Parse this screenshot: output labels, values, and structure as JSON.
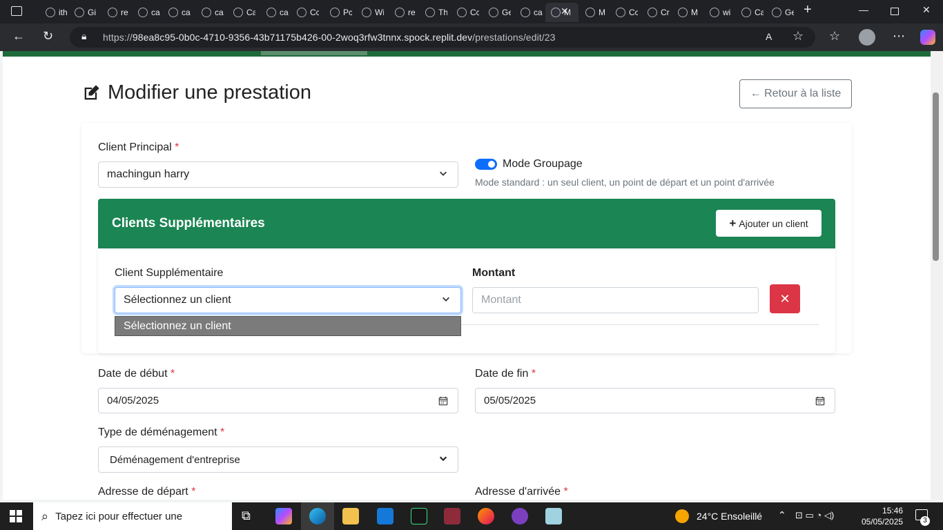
{
  "browser": {
    "tabs": [
      {
        "label": "ith",
        "icon": "search-icon"
      },
      {
        "label": "Gi",
        "icon": "github-icon"
      },
      {
        "label": "re",
        "icon": "search-icon"
      },
      {
        "label": "ca",
        "icon": "replit-icon"
      },
      {
        "label": "ca",
        "icon": "globe-icon"
      },
      {
        "label": "ca",
        "icon": "github-icon"
      },
      {
        "label": "Ca",
        "icon": "globe-icon"
      },
      {
        "label": "ca",
        "icon": "github-icon"
      },
      {
        "label": "Cc",
        "icon": "code-icon"
      },
      {
        "label": "Pc",
        "icon": "code-icon"
      },
      {
        "label": "Wi",
        "icon": "w-icon"
      },
      {
        "label": "re",
        "icon": "search-icon"
      },
      {
        "label": "Th",
        "icon": "globe-icon"
      },
      {
        "label": "Cc",
        "icon": "globe-icon"
      },
      {
        "label": "Ge",
        "icon": "globe-icon"
      },
      {
        "label": "ca",
        "icon": "replit-icon"
      },
      {
        "label": "M",
        "icon": "globe-icon",
        "active": true
      },
      {
        "label": "M",
        "icon": "globe-icon"
      },
      {
        "label": "Cc",
        "icon": "globe-icon"
      },
      {
        "label": "Cr",
        "icon": "globe-icon"
      },
      {
        "label": "M",
        "icon": "globe-icon"
      },
      {
        "label": "wi",
        "icon": "w-icon"
      },
      {
        "label": "Ca",
        "icon": "globe-icon"
      },
      {
        "label": "Ge",
        "icon": "globe-icon"
      }
    ],
    "url_prefix": "https://",
    "url_host": "98ea8c95-0b0c-4710-9356-43b71175b426-00-2woq3rfw3tnnx.spock.replit.dev",
    "url_path": "/prestations/edit/23"
  },
  "page": {
    "title": "Modifier une prestation",
    "back_button": "← Retour à la liste",
    "client_principal_label": "Client Principal",
    "required_mark": "*",
    "client_principal_value": "machingun harry",
    "groupage_label": "Mode Groupage",
    "groupage_help": "Mode standard : un seul client, un point de départ et un point d'arrivée",
    "groupage_on": true,
    "clients_supp_title": "Clients Supplémentaires",
    "add_client_button": "Ajouter un client",
    "client_supp_label": "Client Supplémentaire",
    "client_supp_value": "Sélectionnez un client",
    "montant_label": "Montant",
    "montant_placeholder": "Montant",
    "dropdown_option": "Sélectionnez un client",
    "date_debut_label": "Date de début",
    "date_debut_value": "04/05/2025",
    "date_fin_label": "Date de fin",
    "date_fin_value": "05/05/2025",
    "type_label": "Type de déménagement",
    "type_value": "Déménagement d'entreprise",
    "adresse_depart_label": "Adresse de départ",
    "adresse_arrivee_label": "Adresse d'arrivée"
  },
  "taskbar": {
    "search_placeholder": "Tapez ici pour effectuer une",
    "weather_temp": "24°C",
    "weather_text": "Ensoleillé",
    "time": "15:46",
    "date": "05/05/2025",
    "notifications": "3"
  },
  "colors": {
    "green_panel": "#1b8553",
    "danger": "#dc3545",
    "primary": "#0d6efd"
  }
}
